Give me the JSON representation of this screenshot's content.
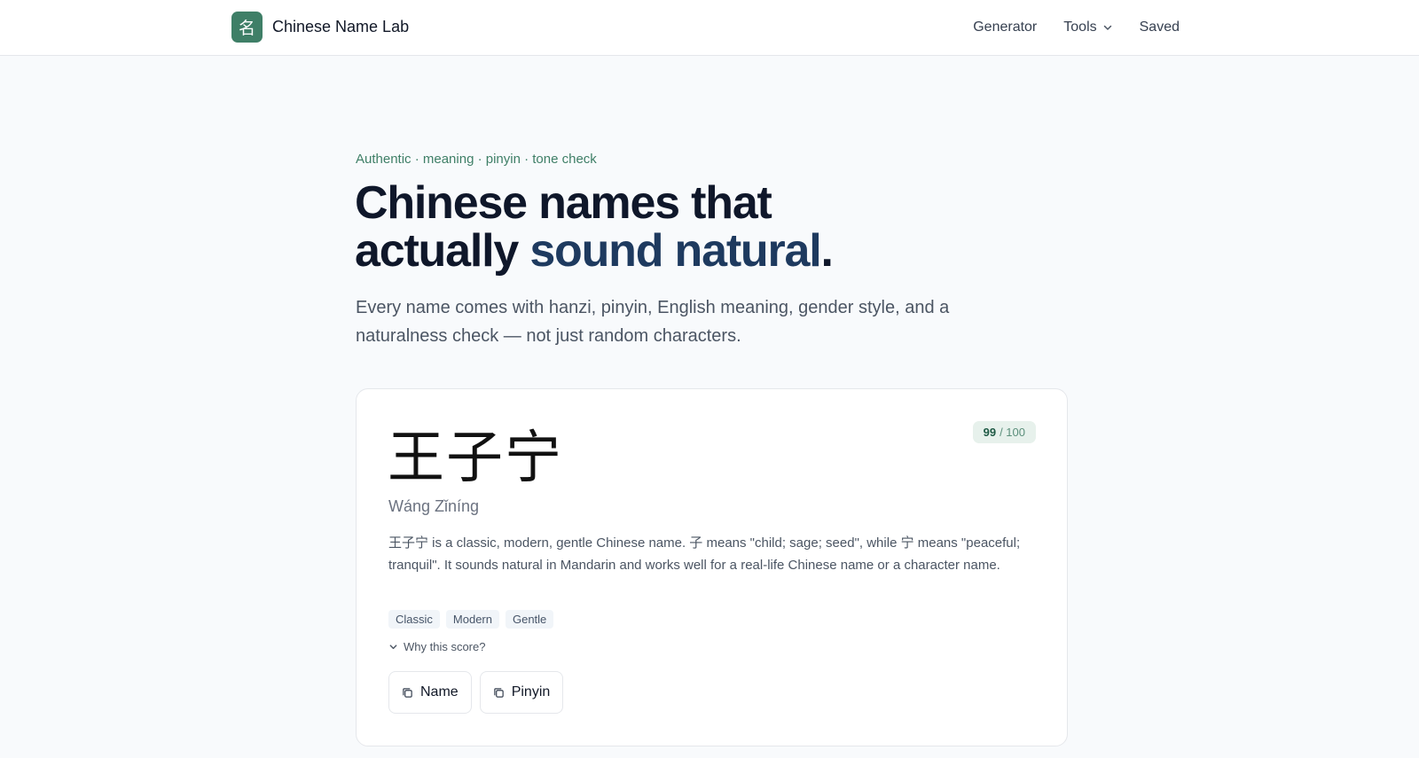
{
  "header": {
    "brand_glyph": "名",
    "brand_name": "Chinese Name Lab",
    "nav": {
      "generator": "Generator",
      "tools": "Tools",
      "saved": "Saved"
    }
  },
  "hero": {
    "eyebrow": "Authentic · meaning · pinyin · tone check",
    "headline_line1": "Chinese names that",
    "headline_line2_prefix": "actually ",
    "headline_accent": "sound natural",
    "headline_period": ".",
    "lede": "Every name comes with hanzi, pinyin, English meaning, gender style, and a naturalness check — not just random characters."
  },
  "card": {
    "hanzi": "王子宁",
    "pinyin": "Wáng Zǐníng",
    "score": "99",
    "score_max": "/ 100",
    "description": "王子宁 is a classic, modern, gentle Chinese name. 子 means \"child; sage; seed\", while 宁 means \"peaceful; tranquil\". It sounds natural in Mandarin and works well for a real-life Chinese name or a character name.",
    "tags": [
      "Classic",
      "Modern",
      "Gentle"
    ],
    "why_label": "Why this score?",
    "copy_name_label": "Name",
    "copy_pinyin_label": "Pinyin"
  },
  "colors": {
    "brand_green": "#3f7f67",
    "accent_navy": "#1e3a5f",
    "page_bg": "#f8fafc"
  }
}
